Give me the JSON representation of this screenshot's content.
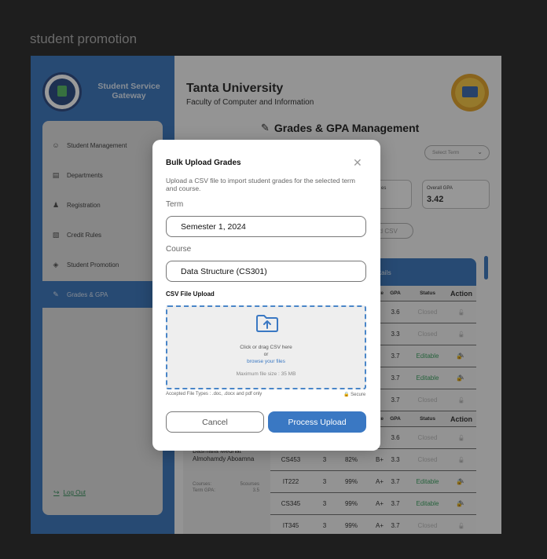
{
  "frame_label": "student promotion",
  "sidebar": {
    "title": "Student Service Gateway",
    "items": [
      {
        "label": "Student Management",
        "icon": "users-icon"
      },
      {
        "label": "Departments",
        "icon": "building-icon"
      },
      {
        "label": "Registration",
        "icon": "user-plus-icon"
      },
      {
        "label": "Credit Rules",
        "icon": "clipboard-icon"
      },
      {
        "label": "Student Promotion",
        "icon": "graduation-cap-icon"
      },
      {
        "label": "Grades & GPA",
        "icon": "edit-document-icon",
        "active": true
      }
    ],
    "logout_label": "Log Out"
  },
  "header": {
    "university": "Tanta University",
    "faculty": "Faculty of Computer and Information"
  },
  "page": {
    "heading": "Grades & GPA Management",
    "select_term_placeholder": "Select Term",
    "stats": [
      {
        "label": "es",
        "value": ""
      },
      {
        "label": "Overall GPA",
        "value": "3.42"
      }
    ],
    "upload_csv_label": "ad CSV",
    "courses_details_title": "rses Details",
    "table_columns": {
      "grade": "ate",
      "gpa": "GPA",
      "status": "Status",
      "action": "Action"
    },
    "student": {
      "name_line1": "Basmalla Medhat",
      "name_line2": "Almohamdy Aboamna",
      "courses_label": "Courses:",
      "courses_value": "5courses",
      "term_gpa_label": "Term GPA:",
      "term_gpa_value": "3.5"
    },
    "rows_top": [
      {
        "gpa": "3.6",
        "status": "Closed",
        "editable": false
      },
      {
        "gpa": "3.3",
        "status": "Closed",
        "editable": false
      },
      {
        "gpa": "3.7",
        "status": "Editable",
        "editable": true
      },
      {
        "gpa": "3.7",
        "status": "Editable",
        "editable": true
      },
      {
        "gpa": "3.7",
        "status": "Closed",
        "editable": false
      }
    ],
    "rows_bottom": [
      {
        "code": "",
        "units": "",
        "pct": "",
        "grade": "",
        "gpa": "3.6",
        "status": "Closed",
        "editable": false
      },
      {
        "code": "CS453",
        "units": "3",
        "pct": "82%",
        "grade": "B+",
        "gpa": "3.3",
        "status": "Closed",
        "editable": false
      },
      {
        "code": "IT222",
        "units": "3",
        "pct": "99%",
        "grade": "A+",
        "gpa": "3.7",
        "status": "Editable",
        "editable": true
      },
      {
        "code": "CS345",
        "units": "3",
        "pct": "99%",
        "grade": "A+",
        "gpa": "3.7",
        "status": "Editable",
        "editable": true
      },
      {
        "code": "IT345",
        "units": "3",
        "pct": "99%",
        "grade": "A+",
        "gpa": "3.7",
        "status": "Closed",
        "editable": false
      }
    ]
  },
  "modal": {
    "title": "Bulk Upload Grades",
    "description": "Upload a CSV file to import student grades for the selected term and course.",
    "term_label": "Term",
    "term_value": "Semester 1, 2024",
    "course_label": "Course",
    "course_value": "Data Structure (CS301)",
    "csv_label": "CSV File Upload",
    "drop_text": "Click or drag CSV here",
    "or_text": "or",
    "browse_text": "browse your files",
    "max_size": "Maximum file size : 35 MB",
    "accepted": "Accepted File Types : .doc, .docx and pdf only",
    "secure": "Secure",
    "cancel_label": "Cancel",
    "process_label": "Process Upload"
  },
  "colors": {
    "primary": "#2f6db8",
    "button": "#3a78c3",
    "editable": "#2d9a55",
    "lock": "#d9534f"
  }
}
